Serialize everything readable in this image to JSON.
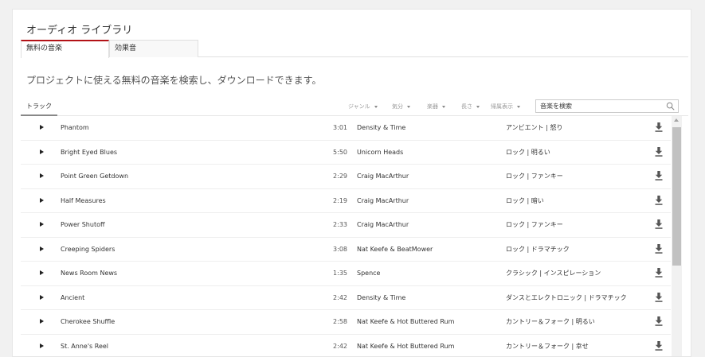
{
  "page": {
    "title": "オーディオ ライブラリ",
    "subtitle": "プロジェクトに使える無料の音楽を検索し、ダウンロードできます。"
  },
  "tabs": [
    {
      "label": "無料の音楽",
      "active": true
    },
    {
      "label": "効果音",
      "active": false
    }
  ],
  "filters": {
    "track_label": "トラック",
    "items": [
      {
        "label": "ジャンル"
      },
      {
        "label": "気分"
      },
      {
        "label": "楽器"
      },
      {
        "label": "長さ"
      },
      {
        "label": "帰属表示"
      }
    ]
  },
  "search": {
    "placeholder": "音楽を検索",
    "icon": "search-icon"
  },
  "tracks": [
    {
      "title": "Phantom",
      "duration": "3:01",
      "artist": "Density & Time",
      "genre": "アンビエント | 怒り"
    },
    {
      "title": "Bright Eyed Blues",
      "duration": "5:50",
      "artist": "Unicorn Heads",
      "genre": "ロック | 明るい"
    },
    {
      "title": "Point Green Getdown",
      "duration": "2:29",
      "artist": "Craig MacArthur",
      "genre": "ロック | ファンキー"
    },
    {
      "title": "Half Measures",
      "duration": "2:19",
      "artist": "Craig MacArthur",
      "genre": "ロック | 暗い"
    },
    {
      "title": "Power Shutoff",
      "duration": "2:33",
      "artist": "Craig MacArthur",
      "genre": "ロック | ファンキー"
    },
    {
      "title": "Creeping Spiders",
      "duration": "3:08",
      "artist": "Nat Keefe & BeatMower",
      "genre": "ロック | ドラマチック"
    },
    {
      "title": "News Room News",
      "duration": "1:35",
      "artist": "Spence",
      "genre": "クラシック | インスピレーション"
    },
    {
      "title": "Ancient",
      "duration": "2:42",
      "artist": "Density & Time",
      "genre": "ダンスとエレクトロニック | ドラマチック"
    },
    {
      "title": "Cherokee Shuffle",
      "duration": "2:58",
      "artist": "Nat Keefe & Hot Buttered Rum",
      "genre": "カントリー＆フォーク | 明るい"
    },
    {
      "title": "St. Anne's Reel",
      "duration": "2:42",
      "artist": "Nat Keefe & Hot Buttered Rum",
      "genre": "カントリー＆フォーク | 幸せ"
    }
  ],
  "icons": {
    "play": "play-icon",
    "download": "download-icon"
  },
  "colors": {
    "accent": "#b31217",
    "text": "#333333",
    "muted": "#999999",
    "background": "#f1f1f1"
  }
}
